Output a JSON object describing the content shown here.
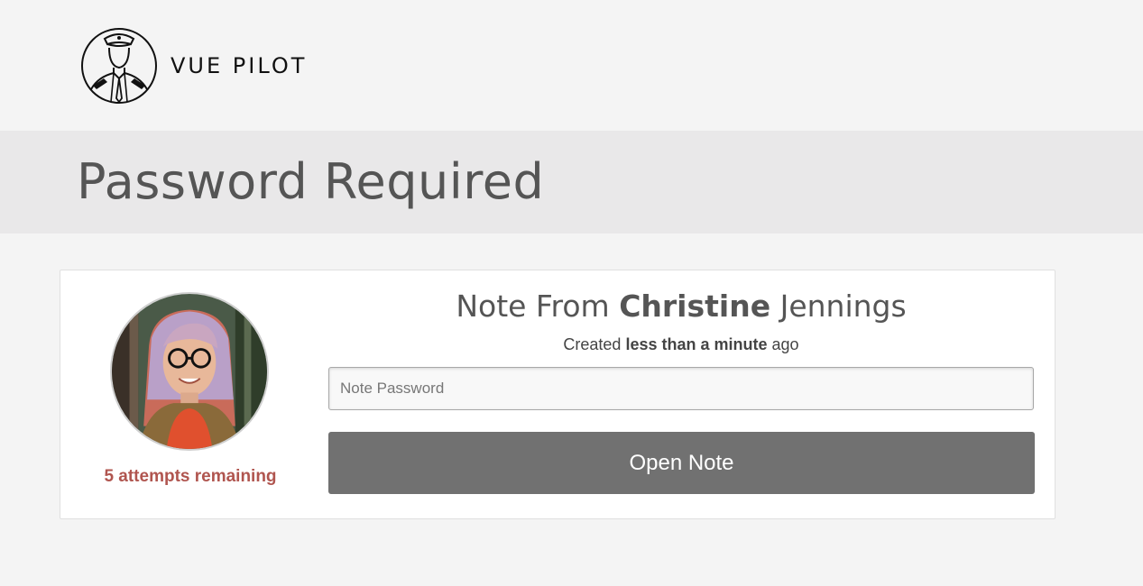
{
  "brand": {
    "name": "VUE PILOT",
    "logo_icon": "pilot-logo-icon"
  },
  "page": {
    "title": "Password Required"
  },
  "note": {
    "heading_prefix": "Note From",
    "sender_first_name": "Christine",
    "sender_last_name": "Jennings",
    "created_prefix": "Created",
    "created_relative": "less than a minute",
    "created_suffix": "ago",
    "attempts_remaining": "5 attempts remaining"
  },
  "form": {
    "password_placeholder": "Note Password",
    "password_value": "",
    "submit_label": "Open Note"
  },
  "colors": {
    "attempts": "#b0554f",
    "button": "#717171",
    "title_band": "#e9e8e9"
  }
}
